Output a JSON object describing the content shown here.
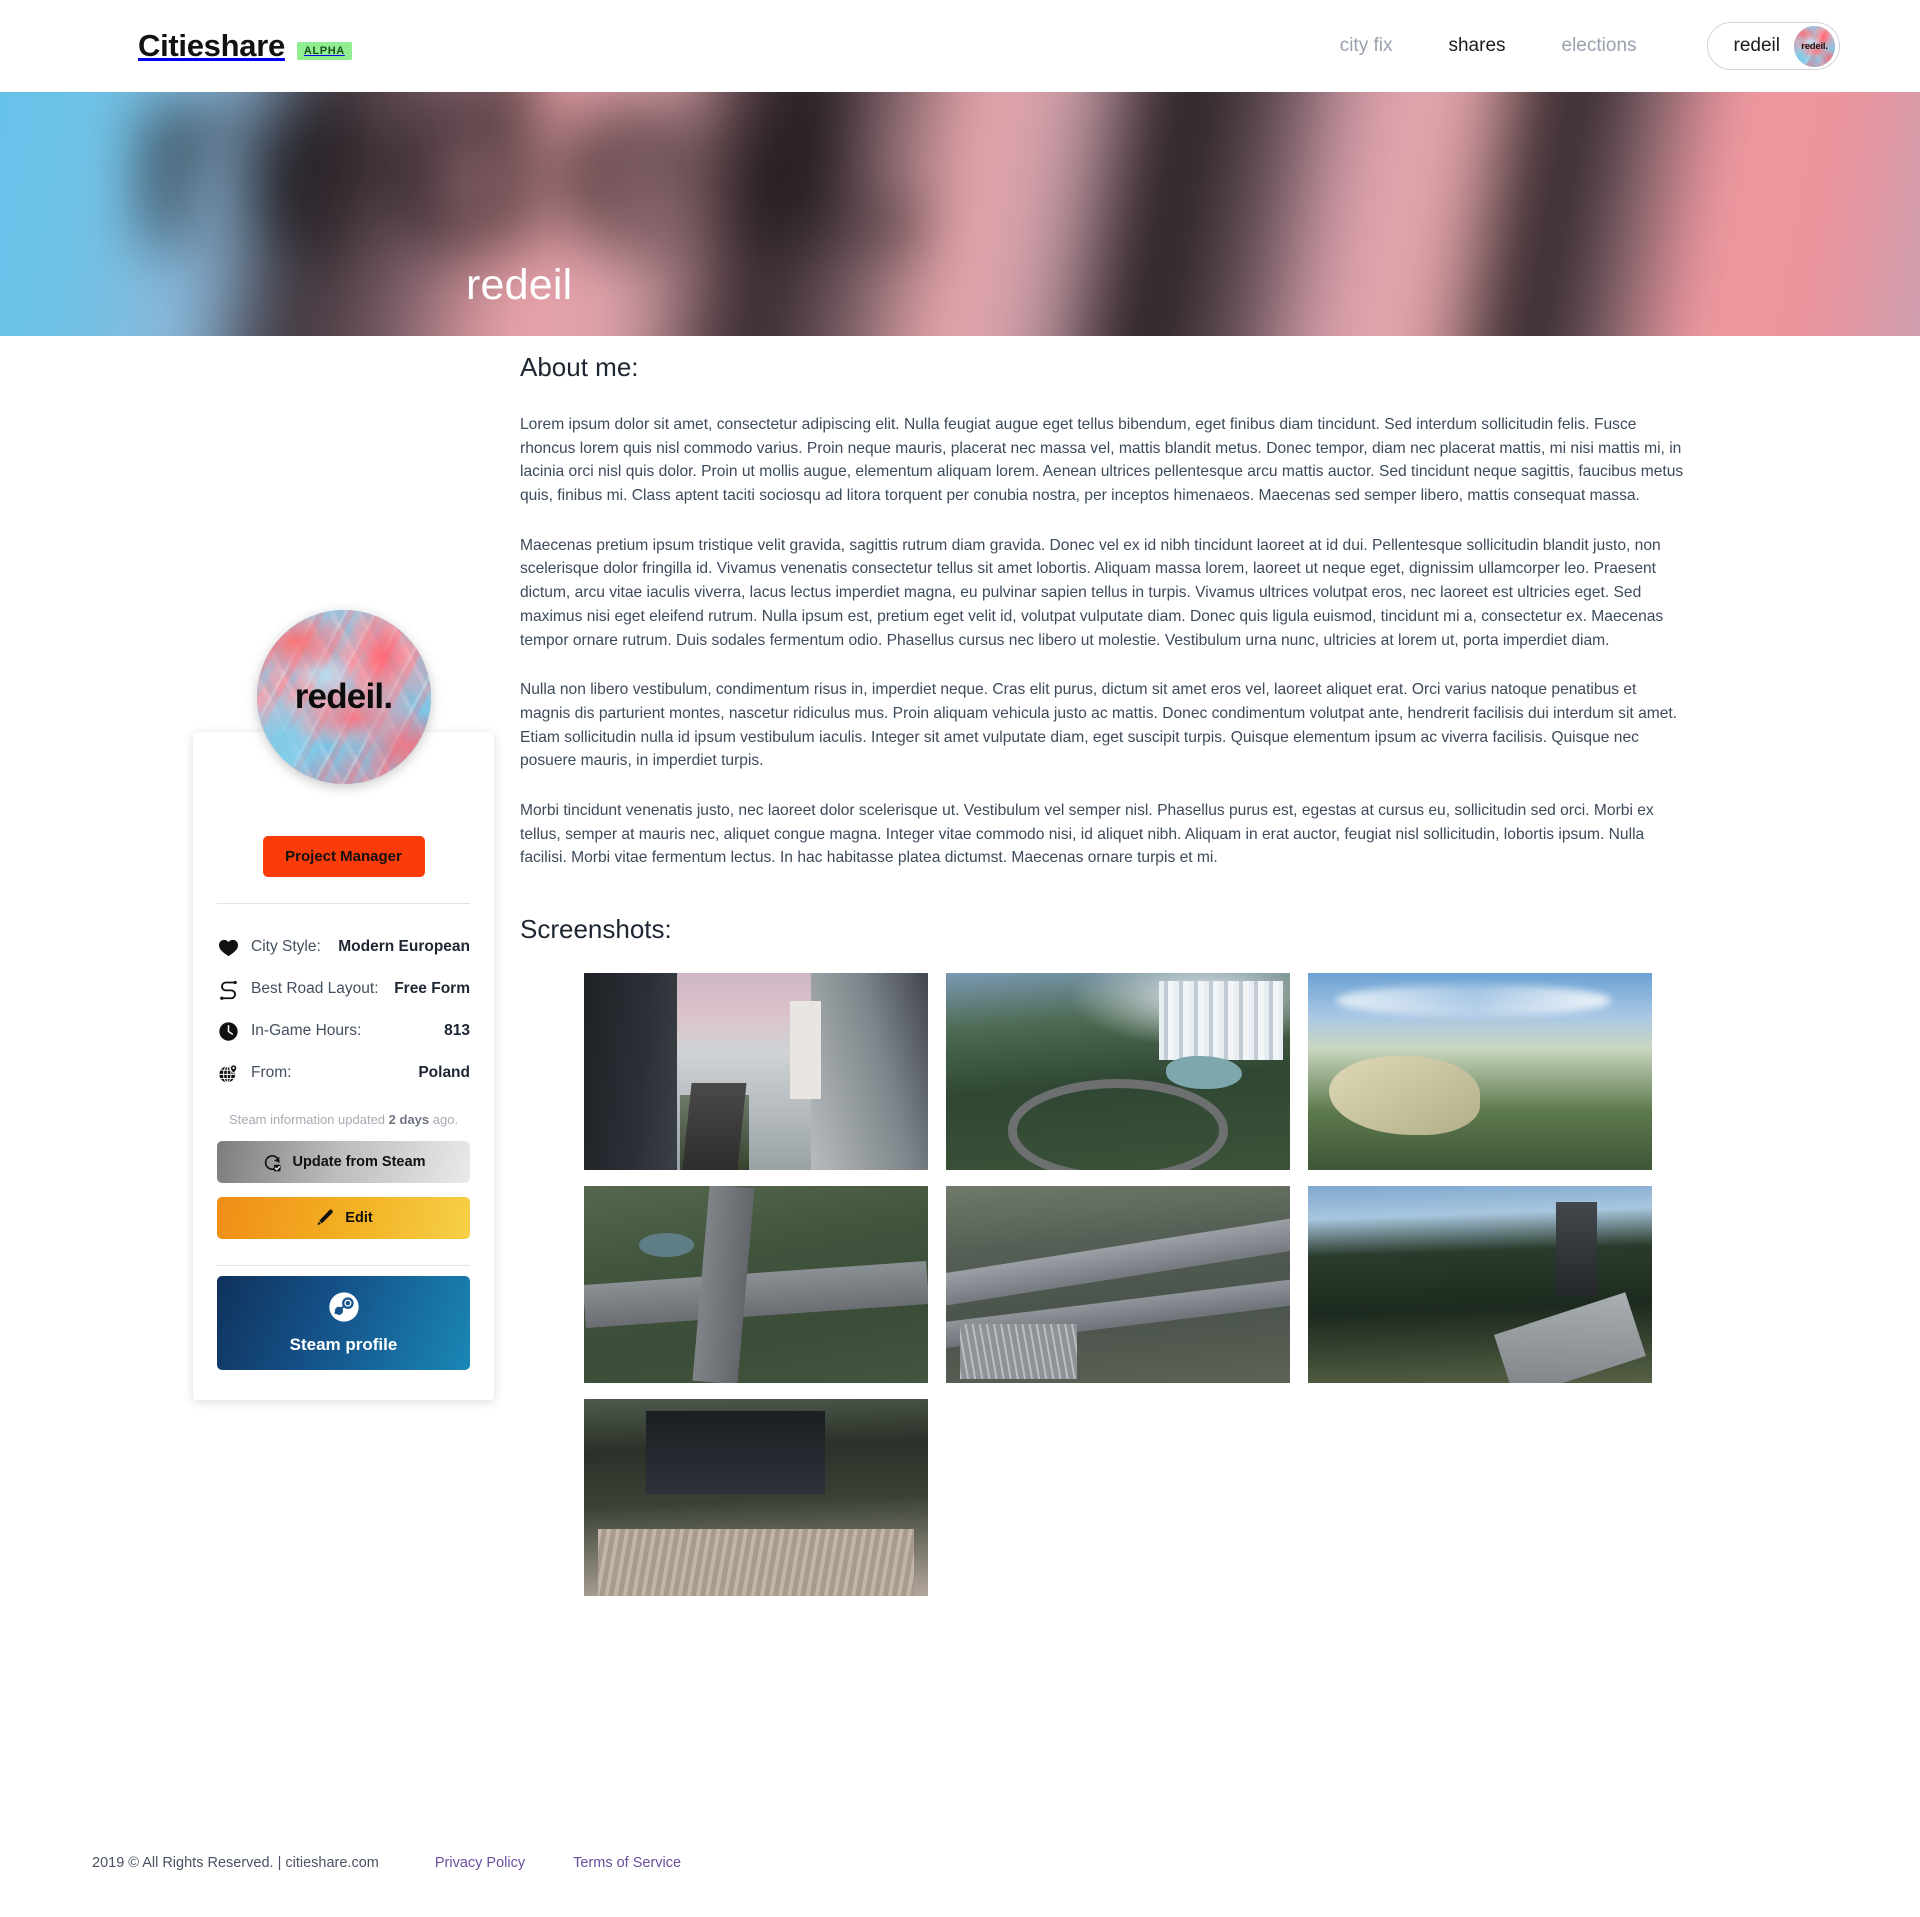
{
  "navbar": {
    "brand": "Citieshare",
    "badge": "ALPHA",
    "links": [
      {
        "label": "city fix",
        "active": false
      },
      {
        "label": "shares",
        "active": true
      },
      {
        "label": "elections",
        "active": false
      }
    ],
    "user": {
      "name": "redeil",
      "avatar_label": "redeil."
    }
  },
  "hero": {
    "ghost_text": "redeil.",
    "display_name": "redeil"
  },
  "profile_card": {
    "avatar_label": "redeil.",
    "role_label": "Project Manager",
    "role_color": "#fb3b08",
    "stats": [
      {
        "icon": "heart-icon",
        "label": "City Style:",
        "value": "Modern European"
      },
      {
        "icon": "road-icon",
        "label": "Best Road Layout:",
        "value": "Free Form"
      },
      {
        "icon": "clock-icon",
        "label": "In-Game Hours:",
        "value": "813"
      },
      {
        "icon": "globe-pin-icon",
        "label": "From:",
        "value": "Poland"
      }
    ],
    "steam_note_prefix": "Steam information updated ",
    "steam_note_strong": "2 days",
    "steam_note_suffix": " ago.",
    "update_button": "Update from Steam",
    "edit_button": "Edit",
    "steam_profile_button": "Steam profile"
  },
  "main": {
    "about_title": "About me:",
    "about_paragraphs": [
      "Lorem ipsum dolor sit amet, consectetur adipiscing elit.\nNulla feugiat augue eget tellus bibendum, eget finibus diam tincidunt. Sed interdum sollicitudin felis. Fusce rhoncus lorem quis nisl commodo varius. Proin neque mauris, placerat nec massa vel, mattis blandit metus. Donec tempor, diam nec placerat mattis, mi nisi mattis mi, in lacinia orci nisl quis dolor. Proin ut mollis augue, elementum aliquam lorem. Aenean ultrices pellentesque arcu mattis auctor. Sed tincidunt neque sagittis, faucibus metus quis, finibus mi. Class aptent taciti sociosqu ad litora torquent per conubia nostra, per inceptos himenaeos. Maecenas sed semper libero, mattis consequat massa.",
      "Maecenas pretium ipsum tristique velit gravida, sagittis rutrum diam gravida. Donec vel ex id nibh tincidunt laoreet at id dui. Pellentesque sollicitudin blandit justo, non scelerisque dolor fringilla id. Vivamus venenatis consectetur tellus sit amet lobortis. Aliquam massa lorem, laoreet ut neque eget, dignissim ullamcorper leo. Praesent dictum, arcu vitae iaculis viverra, lacus lectus imperdiet magna, eu pulvinar sapien tellus in turpis. Vivamus ultrices volutpat eros, nec laoreet est ultricies eget. Sed maximus nisi eget eleifend rutrum. Nulla ipsum est, pretium eget velit id, volutpat vulputate diam. Donec quis ligula euismod, tincidunt mi a, consectetur ex. Maecenas tempor ornare rutrum. Duis sodales fermentum odio. Phasellus cursus nec libero ut molestie. Vestibulum urna nunc, ultricies at lorem ut, porta imperdiet diam.",
      "Nulla non libero vestibulum, condimentum risus in, imperdiet neque. Cras elit purus, dictum sit amet eros vel, laoreet aliquet erat. Orci varius natoque penatibus et magnis dis parturient montes, nascetur ridiculus mus. Proin aliquam vehicula justo ac mattis. Donec condimentum volutpat ante, hendrerit facilisis dui interdum sit amet. Etiam sollicitudin nulla id ipsum vestibulum iaculis. Integer sit amet vulputate diam, eget suscipit turpis. Quisque elementum ipsum ac viverra facilisis. Quisque nec posuere mauris, in imperdiet turpis.",
      "Morbi tincidunt venenatis justo, nec laoreet dolor scelerisque ut. Vestibulum vel semper nisl. Phasellus purus est, egestas at cursus eu, sollicitudin sed orci. Morbi ex tellus, semper at mauris nec, aliquet congue magna. Integer vitae commodo nisi, id aliquet nibh. Aliquam in erat auctor, feugiat nisl sollicitudin, lobortis ipsum. Nulla facilisi. Morbi vitae fermentum lectus. In hac habitasse platea dictumst. Maecenas ornare turpis et mi."
    ],
    "screenshots_title": "Screenshots:",
    "screenshots": [
      {
        "alt": "city-street-gothic-cathedral"
      },
      {
        "alt": "aerial-roundabout-park-skyline"
      },
      {
        "alt": "rocky-hillside-valley-road"
      },
      {
        "alt": "highway-interchange-over-park"
      },
      {
        "alt": "dense-road-junction-parking"
      },
      {
        "alt": "dark-office-tower-riverside-road"
      },
      {
        "alt": "plaza-with-modern-building"
      }
    ]
  },
  "footer": {
    "copyright": "2019 © All Rights Reserved. | citieshare.com",
    "privacy": "Privacy Policy",
    "terms": "Terms of Service",
    "link_color": "#6b4e9e"
  }
}
